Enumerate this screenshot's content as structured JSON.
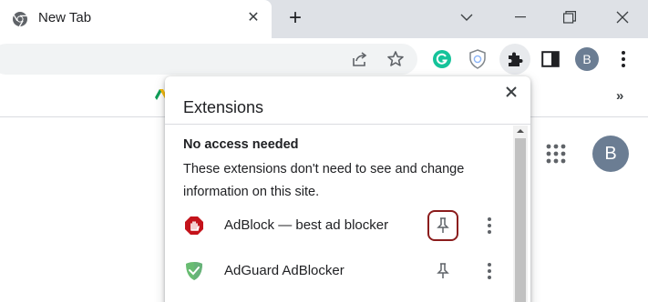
{
  "tab": {
    "title": "New Tab",
    "favicon": "chrome-icon"
  },
  "toolbar": {
    "icons": [
      "share-icon",
      "star-icon",
      "grammarly-icon",
      "shield-extension-icon",
      "puzzle-icon",
      "side-panel-icon",
      "profile-avatar",
      "kebab-menu-icon"
    ],
    "profile_initial": "B"
  },
  "bookmarks": {
    "more_label": "»"
  },
  "page": {
    "avatar_initial": "B",
    "apps_icon": "grid-icon"
  },
  "popup": {
    "title": "Extensions",
    "section_heading": "No access needed",
    "section_description": "These extensions don't need to see and change information on this site.",
    "extensions": [
      {
        "name": "AdBlock — best ad blocker",
        "icon": "adblock-icon",
        "pin_highlighted": true
      },
      {
        "name": "AdGuard AdBlocker",
        "icon": "adguard-icon",
        "pin_highlighted": false
      }
    ]
  },
  "colors": {
    "tabstrip": "#dee1e6",
    "omnibox": "#f1f3f4",
    "grammarly_green": "#15c39a",
    "adblock_red": "#c4131b",
    "adguard_green": "#68bc71",
    "highlight_border": "#8b1c1c",
    "avatar": "#6b7d93"
  }
}
